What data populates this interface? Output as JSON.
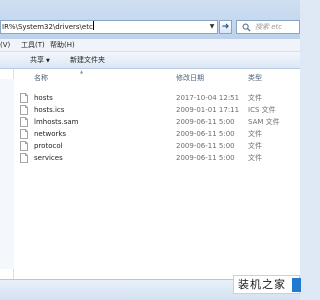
{
  "address": {
    "path": "IR%\\System32\\drivers\\etc",
    "dropdown_icon": "chevron-down-icon",
    "go_icon": "arrow-right-icon"
  },
  "search": {
    "placeholder": "搜索 etc",
    "icon": "search-icon"
  },
  "menu": [
    {
      "label": "(V)"
    },
    {
      "label": "工具(T)"
    },
    {
      "label": "帮助(H)"
    }
  ],
  "toolbar": {
    "share_label": "共享",
    "new_folder_label": "新建文件夹"
  },
  "columns": {
    "name": "名称",
    "modified": "修改日期",
    "type": "类型"
  },
  "files": [
    {
      "name": "hosts",
      "modified": "2017-10-04 12:51",
      "type": "文件"
    },
    {
      "name": "hosts.ics",
      "modified": "2009-01-01 17:11",
      "type": "ICS 文件"
    },
    {
      "name": "lmhosts.sam",
      "modified": "2009-06-11 5:00",
      "type": "SAM 文件"
    },
    {
      "name": "networks",
      "modified": "2009-06-11 5:00",
      "type": "文件"
    },
    {
      "name": "protocol",
      "modified": "2009-06-11 5:00",
      "type": "文件"
    },
    {
      "name": "services",
      "modified": "2009-06-11 5:00",
      "type": "文件"
    }
  ],
  "watermark": {
    "text": "装机之家"
  },
  "colors": {
    "chrome": "#c5d8ef",
    "accent": "#1f7ad0"
  }
}
